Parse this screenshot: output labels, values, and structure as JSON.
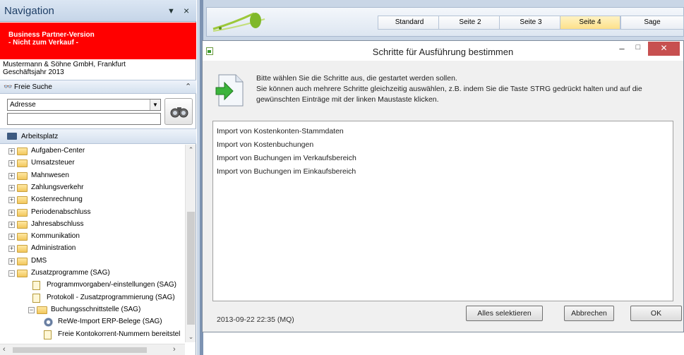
{
  "navigation": {
    "title": "Navigation",
    "dropdown_glyph": "▼",
    "close_glyph": "×",
    "banner_line1": "Business Partner-Version",
    "banner_line2": " - Nicht zum Verkauf -",
    "company_line1": "Mustermann & Söhne GmbH, Frankfurt",
    "company_line2": "Geschäftsjahr 2013",
    "search_section": "Freie Suche",
    "address_select_value": "Adresse",
    "workspace_section": "Arbeitsplatz",
    "tree": [
      {
        "label": "Aufgaben-Center",
        "level": 0,
        "kind": "folder",
        "expander": "+"
      },
      {
        "label": "Umsatzsteuer",
        "level": 0,
        "kind": "folder",
        "expander": "+"
      },
      {
        "label": "Mahnwesen",
        "level": 0,
        "kind": "folder",
        "expander": "+"
      },
      {
        "label": "Zahlungsverkehr",
        "level": 0,
        "kind": "folder",
        "expander": "+"
      },
      {
        "label": "Kostenrechnung",
        "level": 0,
        "kind": "folder",
        "expander": "+"
      },
      {
        "label": "Periodenabschluss",
        "level": 0,
        "kind": "folder",
        "expander": "+"
      },
      {
        "label": "Jahresabschluss",
        "level": 0,
        "kind": "folder",
        "expander": "+"
      },
      {
        "label": "Kommunikation",
        "level": 0,
        "kind": "folder",
        "expander": "+"
      },
      {
        "label": "Administration",
        "level": 0,
        "kind": "folder",
        "expander": "+"
      },
      {
        "label": "DMS",
        "level": 0,
        "kind": "folder",
        "expander": "+"
      },
      {
        "label": "Zusatzprogramme (SAG)",
        "level": 0,
        "kind": "folder",
        "expander": "−"
      },
      {
        "label": "Programmvorgaben/-einstellungen (SAG)",
        "level": 1,
        "kind": "doc",
        "expander": ""
      },
      {
        "label": "Protokoll - Zusatzprogrammierung (SAG)",
        "level": 1,
        "kind": "doc",
        "expander": ""
      },
      {
        "label": "Buchungsschnittstelle (SAG)",
        "level": 1,
        "kind": "folder",
        "expander": "−"
      },
      {
        "label": "ReWe-Import ERP-Belege (SAG)",
        "level": 2,
        "kind": "gear",
        "expander": ""
      },
      {
        "label": "Freie Kontokorrent-Nummern bereitstel",
        "level": 2,
        "kind": "doc",
        "expander": ""
      }
    ]
  },
  "topbar": {
    "tabs": [
      {
        "label": "Standard",
        "active": false
      },
      {
        "label": "Seite 2",
        "active": false
      },
      {
        "label": "Seite 3",
        "active": false
      },
      {
        "label": "Seite 4",
        "active": true
      },
      {
        "label": "Sage",
        "active": false
      }
    ]
  },
  "dialog": {
    "title": "Schritte für Ausführung bestimmen",
    "minimize_glyph": "–",
    "maximize_glyph": "□",
    "close_glyph": "✕",
    "instruction_line1": "Bitte wählen Sie die Schritte aus, die gestartet werden sollen.",
    "instruction_line2": "Sie können auch mehrere Schritte gleichzeitig auswählen, z.B. indem Sie die Taste STRG gedrückt halten und auf die",
    "instruction_line3": "gewünschten Einträge mit der linken Maustaste klicken.",
    "steps": [
      "Import von Kostenkonten-Stammdaten",
      "Import von Kostenbuchungen",
      "Import von Buchungen im Verkaufsbereich",
      "Import von Buchungen im Einkaufsbereich"
    ],
    "footer_timestamp": "2013-09-22 22:35 (MQ)",
    "select_all_label": "Alles selektieren",
    "cancel_label": "Abbrechen",
    "ok_label": "OK"
  },
  "colors": {
    "banner": "#ff0000",
    "active_tab": "#fde08a",
    "close_button": "#c75050"
  }
}
